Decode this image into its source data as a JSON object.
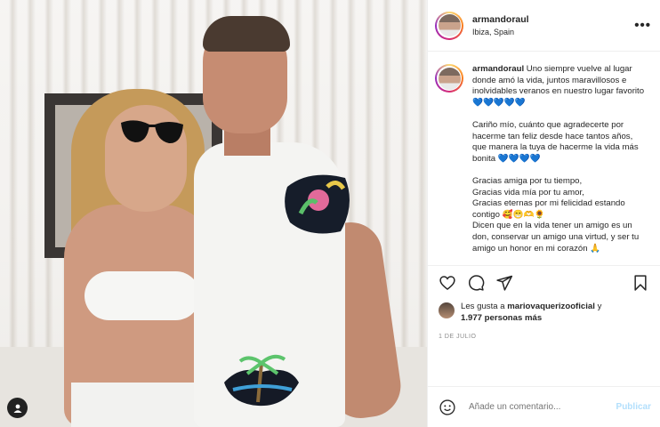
{
  "post": {
    "username": "armandoraul",
    "location": "Ibiza, Spain",
    "more_icon": "more-horizontal-icon"
  },
  "caption": {
    "username": "armandoraul",
    "paragraphs": [
      "Uno siempre vuelve al lugar donde amó la vida, juntos maravillosos e inolvidables veranos en nuestro lugar favorito 💙💙💙💙💙",
      "Cariño mío, cuánto que agradecerte por hacerme tan feliz desde hace tantos años, que manera la tuya de hacerme la vida más bonita 💙💙💙💙",
      "Gracias amiga por tu tiempo,\nGracias vida mía por tu amor,\nGracias eternas por mi felicidad estando contigo 🥰😁🫶🌻\nDicen que en la vida tener un amigo es un don, conservar un amigo una virtud, y ser tu amigo un honor en mi corazón 🙏"
    ]
  },
  "actions": {
    "like_icon": "heart-icon",
    "comment_icon": "comment-icon",
    "share_icon": "send-icon",
    "save_icon": "bookmark-icon"
  },
  "likes": {
    "prefix": "Les gusta a ",
    "user": "mariovaquerizooficial",
    "conjunction": " y ",
    "count": "1.977 personas más"
  },
  "date": "1 DE JULIO",
  "comment_box": {
    "emoji_icon": "smiley-icon",
    "placeholder": "Añade un comentario...",
    "post_label": "Publicar"
  },
  "colors": {
    "text": "#262626",
    "muted": "#8e8e8e",
    "post_button_disabled": "#b2dffc",
    "divider": "#efefef"
  }
}
